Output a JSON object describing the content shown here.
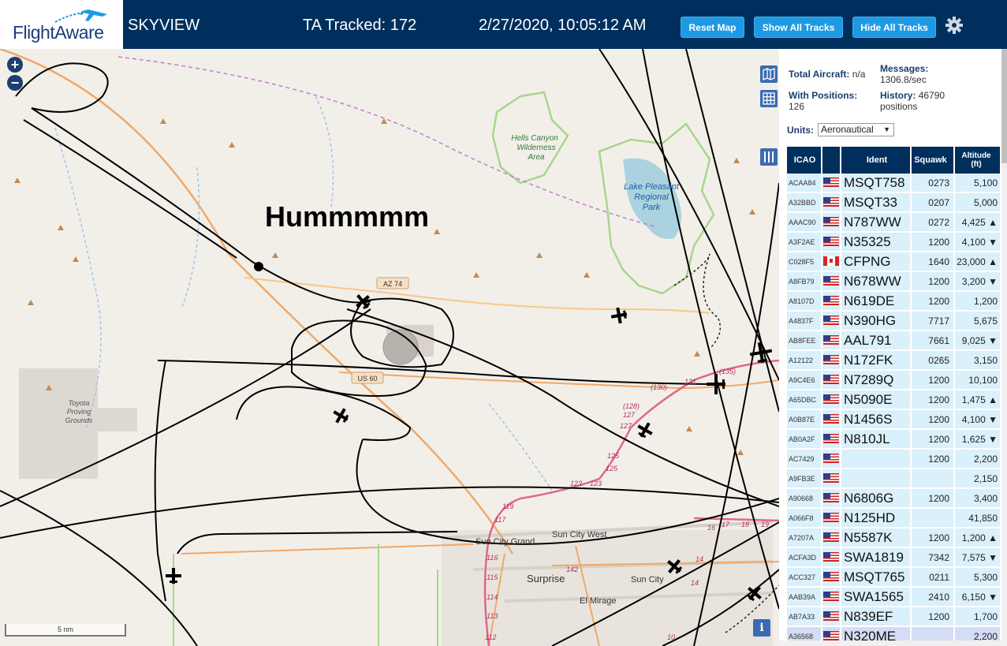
{
  "header": {
    "logo_text": "FlightAware",
    "app_title": "SKYVIEW",
    "tracked": "TA Tracked: 172",
    "datetime": "2/27/2020, 10:05:12 AM",
    "buttons": {
      "reset": "Reset Map",
      "show_all": "Show All Tracks",
      "hide_all": "Hide All Tracks"
    }
  },
  "map": {
    "annotation": "Hummmmm",
    "scale_label": "5 nm",
    "zoom_in": "+",
    "zoom_out": "−",
    "info": "i",
    "labels": {
      "hells_canyon_1": "Hells Canyon",
      "hells_canyon_2": "Wilderness",
      "hells_canyon_3": "Area",
      "lake_1": "Lake Pleasant",
      "lake_2": "Regional",
      "lake_3": "Park",
      "toyota_1": "Toyota",
      "toyota_2": "Proving",
      "toyota_3": "Grounds",
      "az74": "AZ 74",
      "us60": "US 60",
      "sun_city_grand": "Sun City Grand",
      "sun_city_west": "Sun City West",
      "surprise": "Surprise",
      "sun_city": "Sun City",
      "el_mirage": "El Mirage",
      "r135": "(135)",
      "r131": "131",
      "r130": "(130)",
      "r128": "(128)",
      "r127a": "127",
      "r127b": "127",
      "r125a": "125",
      "r125b": "125",
      "r123a": "123",
      "r123b": "123",
      "r119": "119",
      "r117": "117",
      "r116": "116",
      "r115": "115",
      "r114": "114",
      "r113": "113",
      "r112": "112",
      "r142": "142",
      "e16": "16",
      "e17": "17",
      "e18": "18",
      "e19": "19",
      "e14a": "14",
      "e14b": "14",
      "e10": "10"
    }
  },
  "panel": {
    "total_aircraft_label": "Total Aircraft:",
    "total_aircraft_value": "n/a",
    "messages_label": "Messages:",
    "messages_value": "1306.8/sec",
    "with_positions_label": "With Positions:",
    "with_positions_value": "126",
    "history_label": "History:",
    "history_value": "46790",
    "history_unit": "positions",
    "units_label": "Units:",
    "units_value": "Aeronautical",
    "columns": {
      "icao": "ICAO",
      "ident": "Ident",
      "squawk": "Squawk",
      "altitude_1": "Altitude",
      "altitude_2": "(ft)"
    },
    "rows": [
      {
        "icao": "ACAA84",
        "flag": "us",
        "ident": "MSQT758",
        "squawk": "0273",
        "alt": "5,100"
      },
      {
        "icao": "A32BBD",
        "flag": "us",
        "ident": "MSQT33",
        "squawk": "0207",
        "alt": "5,000"
      },
      {
        "icao": "AAAC90",
        "flag": "us",
        "ident": "N787WW",
        "squawk": "0272",
        "alt": "4,425 ▲"
      },
      {
        "icao": "A3F2AE",
        "flag": "us",
        "ident": "N35325",
        "squawk": "1200",
        "alt": "4,100 ▼"
      },
      {
        "icao": "C028F5",
        "flag": "ca",
        "ident": "CFPNG",
        "squawk": "1640",
        "alt": "23,000 ▲"
      },
      {
        "icao": "A8FB79",
        "flag": "us",
        "ident": "N678WW",
        "squawk": "1200",
        "alt": "3,200 ▼"
      },
      {
        "icao": "A8107D",
        "flag": "us",
        "ident": "N619DE",
        "squawk": "1200",
        "alt": "1,200"
      },
      {
        "icao": "A4837F",
        "flag": "us",
        "ident": "N390HG",
        "squawk": "7717",
        "alt": "5,675"
      },
      {
        "icao": "AB8FEE",
        "flag": "us",
        "ident": "AAL791",
        "squawk": "7661",
        "alt": "9,025 ▼"
      },
      {
        "icao": "A12122",
        "flag": "us",
        "ident": "N172FK",
        "squawk": "0265",
        "alt": "3,150"
      },
      {
        "icao": "A9C4E6",
        "flag": "us",
        "ident": "N7289Q",
        "squawk": "1200",
        "alt": "10,100"
      },
      {
        "icao": "A65DBC",
        "flag": "us",
        "ident": "N5090E",
        "squawk": "1200",
        "alt": "1,475 ▲"
      },
      {
        "icao": "A0B87E",
        "flag": "us",
        "ident": "N1456S",
        "squawk": "1200",
        "alt": "4,100 ▼"
      },
      {
        "icao": "AB0A2F",
        "flag": "us",
        "ident": "N810JL",
        "squawk": "1200",
        "alt": "1,625 ▼"
      },
      {
        "icao": "AC7429",
        "flag": "us",
        "ident": "",
        "squawk": "1200",
        "alt": "2,200"
      },
      {
        "icao": "A9FB3E",
        "flag": "us",
        "ident": "",
        "squawk": "",
        "alt": "2,150"
      },
      {
        "icao": "A90668",
        "flag": "us",
        "ident": "N6806G",
        "squawk": "1200",
        "alt": "3,400"
      },
      {
        "icao": "A066F8",
        "flag": "us",
        "ident": "N125HD",
        "squawk": "",
        "alt": "41,850"
      },
      {
        "icao": "A7207A",
        "flag": "us",
        "ident": "N5587K",
        "squawk": "1200",
        "alt": "1,200 ▲"
      },
      {
        "icao": "ACFA3D",
        "flag": "us",
        "ident": "SWA1819",
        "squawk": "7342",
        "alt": "7,575 ▼"
      },
      {
        "icao": "ACC327",
        "flag": "us",
        "ident": "MSQT765",
        "squawk": "0211",
        "alt": "5,300"
      },
      {
        "icao": "AAB39A",
        "flag": "us",
        "ident": "SWA1565",
        "squawk": "2410",
        "alt": "6,150 ▼"
      },
      {
        "icao": "AB7A33",
        "flag": "us",
        "ident": "N839EF",
        "squawk": "1200",
        "alt": "1,700"
      },
      {
        "icao": "A36568",
        "flag": "us",
        "ident": "N320ME",
        "squawk": "",
        "alt": "2,200"
      }
    ]
  },
  "colors": {
    "header_bg": "#002f5d",
    "button_bg": "#1e9ae4",
    "table_row_bg": "#daf0fb",
    "selected_row_bg": "#d4dcf6",
    "track_line": "#000000",
    "highway_orange": "#f0a868",
    "rail_pink": "#e0668a",
    "park_border": "#a6d68b",
    "lake_fill": "#aad3df"
  }
}
